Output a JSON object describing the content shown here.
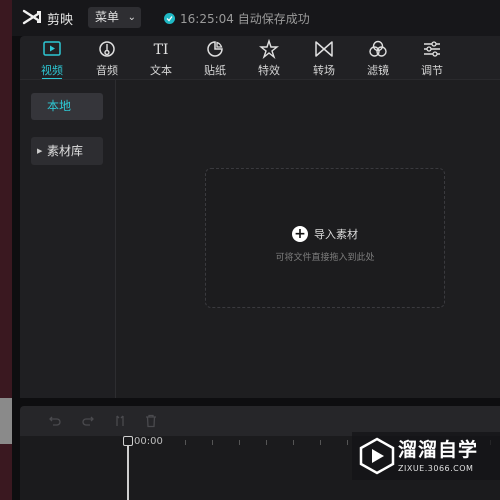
{
  "titlebar": {
    "app_name": "剪映",
    "menu_label": "菜单",
    "status_text": "16:25:04 自动保存成功"
  },
  "toolbar": {
    "items": [
      {
        "label": "视频",
        "icon": "video-icon",
        "active": true
      },
      {
        "label": "音频",
        "icon": "audio-icon"
      },
      {
        "label": "文本",
        "icon": "text-icon"
      },
      {
        "label": "贴纸",
        "icon": "sticker-icon"
      },
      {
        "label": "特效",
        "icon": "effects-icon"
      },
      {
        "label": "转场",
        "icon": "transition-icon"
      },
      {
        "label": "滤镜",
        "icon": "filter-icon"
      },
      {
        "label": "调节",
        "icon": "adjust-icon"
      }
    ]
  },
  "sidebar": {
    "local_label": "本地",
    "library_label": "素材库"
  },
  "main": {
    "import_label": "导入素材",
    "hint": "可将文件直接拖入到此处"
  },
  "timeline": {
    "time": "00:00"
  },
  "watermark": {
    "title": "溜溜自学",
    "subtitle": "ZIXUE.3066.COM"
  },
  "colors": {
    "accent": "#2ec7d3",
    "background": "#1e1e20"
  }
}
